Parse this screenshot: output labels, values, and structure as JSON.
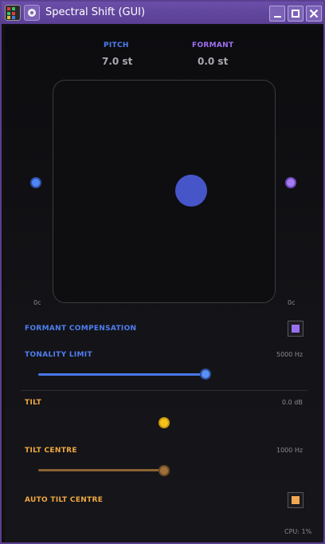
{
  "window": {
    "title": "Spectral Shift (GUI)",
    "icons": [
      "app-icon",
      "pin-icon"
    ],
    "controls": [
      "minimize-icon",
      "maximize-icon",
      "close-icon"
    ]
  },
  "header": {
    "pitch_label": "PITCH",
    "pitch_value": "7.0 st",
    "formant_label": "FORMANT",
    "formant_value": "0.0 st"
  },
  "xy_pad": {
    "left_marker": "0c",
    "right_marker": "0c"
  },
  "formant_compensation": {
    "label": "FORMANT COMPENSATION",
    "checked": true
  },
  "tonality_limit": {
    "label": "TONALITY LIMIT",
    "value": "5000 Hz",
    "position": 0.9
  },
  "tilt": {
    "label": "TILT",
    "value": "0.0 dB",
    "position": 0.5
  },
  "tilt_centre": {
    "label": "TILT CENTRE",
    "value": "1000 Hz",
    "position": 0.7
  },
  "auto_tilt_centre": {
    "label": "AUTO TILT CENTRE",
    "checked": true
  },
  "status": {
    "cpu": "CPU: 1%"
  },
  "colors": {
    "pitch": "#4f86f7",
    "formant": "#a57bf4",
    "tilt": "#f0c020",
    "tilt_centre": "#a0703c",
    "frame": "#5b3f91"
  }
}
